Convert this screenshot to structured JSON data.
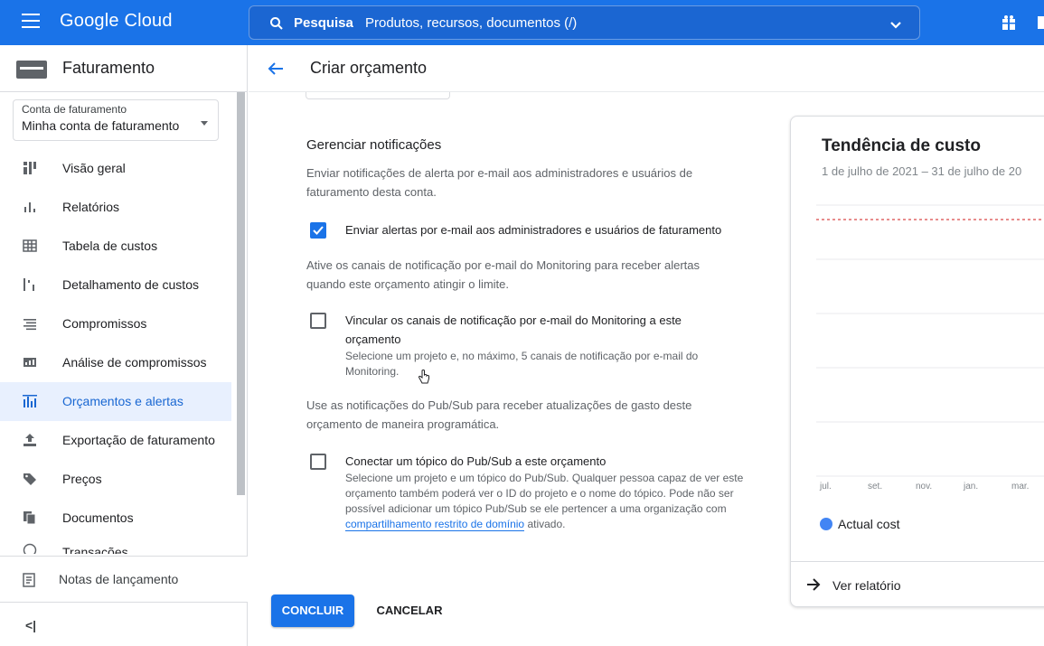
{
  "topbar": {
    "brand": "Google Cloud",
    "search_label": "Pesquisa",
    "search_placeholder": "Produtos, recursos, documentos (/)"
  },
  "sidebar": {
    "title": "Faturamento",
    "account_label": "Conta de faturamento",
    "account_value": "Minha conta de faturamento",
    "items": [
      {
        "label": "Visão geral",
        "icon": "dashboard-icon"
      },
      {
        "label": "Relatórios",
        "icon": "bar-chart-icon"
      },
      {
        "label": "Tabela de custos",
        "icon": "table-icon"
      },
      {
        "label": "Detalhamento de custos",
        "icon": "breakdown-icon"
      },
      {
        "label": "Compromissos",
        "icon": "list-icon"
      },
      {
        "label": "Análise de compromissos",
        "icon": "analysis-icon"
      },
      {
        "label": "Orçamentos e alertas",
        "icon": "budget-icon",
        "active": true
      },
      {
        "label": "Exportação de faturamento",
        "icon": "upload-icon"
      },
      {
        "label": "Preços",
        "icon": "tag-icon"
      },
      {
        "label": "Documentos",
        "icon": "documents-icon"
      },
      {
        "label": "Transações",
        "icon": "clock-icon"
      }
    ],
    "release_notes": "Notas de lançamento",
    "collapse": "<|"
  },
  "page": {
    "title": "Criar orçamento"
  },
  "notifications": {
    "heading": "Gerenciar notificações",
    "intro": "Enviar notificações de alerta por e-mail aos administradores e usuários de faturamento desta conta.",
    "email_alerts_label": "Enviar alertas por e-mail aos administradores e usuários de faturamento",
    "email_alerts_checked": true,
    "monitoring_intro": "Ative os canais de notificação por e-mail do Monitoring para receber alertas quando este orçamento atingir o limite.",
    "monitoring_label": "Vincular os canais de notificação por e-mail do Monitoring a este orçamento",
    "monitoring_checked": false,
    "monitoring_help": "Selecione um projeto e, no máximo, 5 canais de notificação por e-mail do Monitoring.",
    "pubsub_intro": "Use as notificações do Pub/Sub para receber atualizações de gasto deste orçamento de maneira programática.",
    "pubsub_label": "Conectar um tópico do Pub/Sub a este orçamento",
    "pubsub_checked": false,
    "pubsub_help": "Selecione um projeto e um tópico do Pub/Sub. Qualquer pessoa capaz de ver este orçamento também poderá ver o ID do projeto e o nome do tópico. Pode não ser possível adicionar um tópico Pub/Sub se ele pertencer a uma organização com",
    "pubsub_link": "compartilhamento restrito de domínio",
    "pubsub_help_end": "ativado."
  },
  "actions": {
    "submit": "CONCLUIR",
    "cancel": "CANCELAR"
  },
  "cost_card": {
    "title": "Tendência de custo",
    "date_range": "1 de julho de 2021 – 31 de julho de 20",
    "legend": "Actual cost",
    "view_report": "Ver relatório"
  },
  "colors": {
    "accent": "#1a73e8",
    "budget_line": "#e06666",
    "actual_cost": "#4285f4"
  },
  "chart_data": {
    "type": "line",
    "title": "Tendência de custo",
    "x": [
      "jul.",
      "set.",
      "nov.",
      "jan.",
      "mar."
    ],
    "series": [
      {
        "name": "Actual cost",
        "values": []
      }
    ],
    "grid": true,
    "legend": "bottom-left"
  }
}
